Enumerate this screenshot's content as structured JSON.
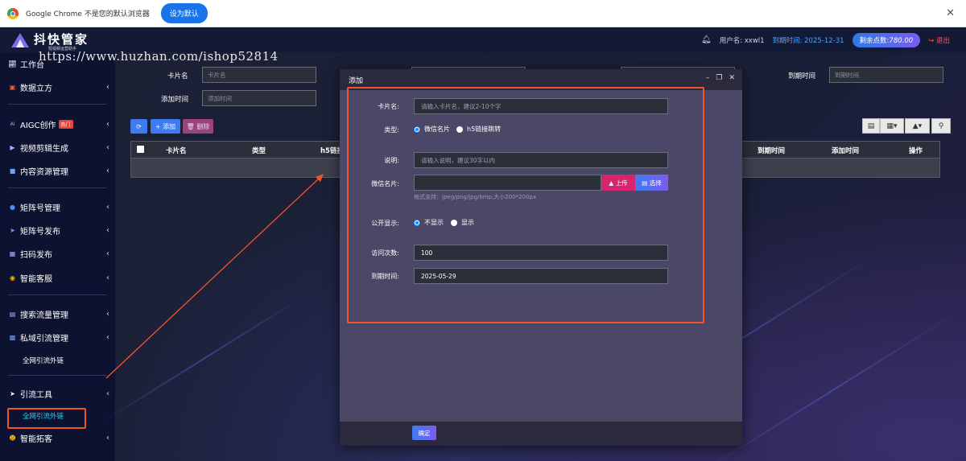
{
  "chrome": {
    "message": "Google Chrome 不是您的默认浏览器",
    "set_default": "设为默认",
    "close": "✕"
  },
  "brand": {
    "name": "抖快管家",
    "tagline": "短视频运营助手",
    "logo_icon": "brand-logo-icon"
  },
  "topbar": {
    "bell_icon": "bell-icon",
    "user": "用户名: xxwl1",
    "expire": "到期时间: 2025-12-31",
    "points_label": "剩余点数:",
    "points_value": "780.00",
    "logout": "退出"
  },
  "watermark": "https://www.huzhan.com/ishop52814",
  "sidebar": {
    "items": [
      {
        "label": "工作台",
        "icon": "chart-icon"
      },
      {
        "label": "数据立方",
        "icon": "cube-icon"
      },
      {
        "label": "AIGC创作",
        "icon": "ai-icon",
        "badge": "热门"
      },
      {
        "label": "视频剪辑生成",
        "icon": "video-icon"
      },
      {
        "label": "内容资源管理",
        "icon": "folder-icon"
      },
      {
        "label": "矩阵号管理",
        "icon": "circle-icon"
      },
      {
        "label": "矩阵号发布",
        "icon": "send-icon"
      },
      {
        "label": "扫码发布",
        "icon": "qrcode-icon"
      },
      {
        "label": "智能客服",
        "icon": "service-icon"
      },
      {
        "label": "搜索流量管理",
        "icon": "search-traffic-icon"
      },
      {
        "label": "私域引流管理",
        "icon": "private-icon"
      },
      {
        "label": "引流工具",
        "icon": "paper-plane-icon"
      },
      {
        "label": "智能拓客",
        "icon": "user-plus-icon"
      }
    ],
    "sub_1": "全网引流外链",
    "sub_2": "全网引流外链"
  },
  "filters": {
    "card_name_label": "卡片名",
    "card_name_placeholder": "卡片名",
    "add_time_label": "添加时间",
    "add_time_placeholder": "添加时间",
    "expire_label": "到期时间",
    "expire_placeholder": "到期时间"
  },
  "toolbar": {
    "refresh_icon": "refresh-icon",
    "add": "+ 添加",
    "delete": "🗑 删除"
  },
  "table": {
    "columns": [
      "卡片名",
      "类型",
      "h5链接",
      "到期时间",
      "添加时间",
      "操作"
    ]
  },
  "modal": {
    "title": "添加",
    "fields": {
      "card_name_label": "卡片名:",
      "card_name_placeholder": "请输入卡片名，建议2-10个字",
      "type_label": "类型:",
      "type_opt1": "微信名片",
      "type_opt2": "h5链接跳转",
      "desc_label": "说明:",
      "desc_placeholder": "请输入说明，建议30字以内",
      "wechat_label": "微信名片:",
      "upload": "上传",
      "select": "选择",
      "format_hint": "格式支持：jpeg/png/jpg/bmp,大小200*200px",
      "public_label": "公开显示:",
      "public_opt1": "不显示",
      "public_opt2": "显示",
      "visits_label": "访问次数:",
      "visits_value": "100",
      "expire_label": "到期时间:",
      "expire_value": "2025-05-29"
    },
    "confirm": "确定"
  },
  "colors": {
    "accent": "#3f7bf0",
    "highlight": "#f0562a",
    "danger": "#d6246e",
    "expire_text": "#4aa8ff"
  }
}
